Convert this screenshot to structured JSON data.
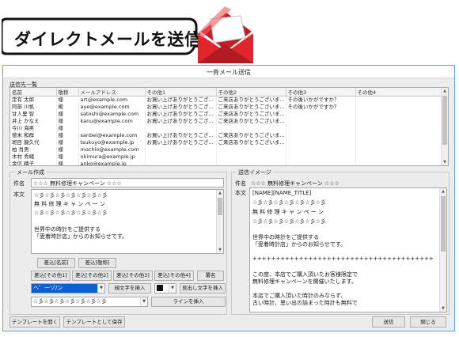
{
  "banner": {
    "text": "ダイレクトメールを送信"
  },
  "window": {
    "title": "一斉メール送信"
  },
  "recipients": {
    "label": "送信先一覧",
    "columns": [
      "名前",
      "敬称",
      "メールアドレス",
      "その他1",
      "その他2",
      "その他3",
      "その他4"
    ],
    "rows": [
      [
        "定有 太郎",
        "様",
        "art@example.com",
        "お買い上げありがとうござ...",
        "ご来店ありがとうございま...",
        "その後いかがですか？",
        ""
      ],
      [
        "阿部 川帆",
        "殿",
        "aye@example.com",
        "お買い上げありがとうござ...",
        "ご来店ありがとうございま...",
        "その後いかがですか？",
        ""
      ],
      [
        "甘人里 智",
        "様",
        "satoshi@example.com",
        "お買い上げありがとうござ...",
        "ご来店ありがとうございま...",
        "",
        ""
      ],
      [
        "井上 かなえ",
        "様",
        "kanu@example.com",
        "お買い上げありがとうござ...",
        "ご来店ありがとうございま...",
        "",
        ""
      ],
      [
        "今川 海男",
        "様",
        "",
        "",
        "",
        "",
        ""
      ],
      [
        "徳米 和群",
        "様",
        "sanbei@example.com",
        "お買い上げありがとうござ...",
        "ご来店ありがとうございま...",
        "",
        ""
      ],
      [
        "斑目 龍久代",
        "様",
        "tsukuyo@example.jp",
        "お買い上げありがとうござ...",
        "ご来店ありがとうございま...",
        "",
        ""
      ],
      [
        "柏 肖男",
        "様",
        "mochio@example.com",
        "",
        "",
        "",
        ""
      ],
      [
        "木村 秀緒",
        "様",
        "nkimura@example.jp",
        "",
        "",
        "",
        ""
      ],
      [
        "金信 精子",
        "様",
        "anko@example.jp",
        "",
        "",
        "",
        ""
      ]
    ]
  },
  "compose": {
    "group_title": "メール作成",
    "subject_label": "件名",
    "subject_value": "☆☆☆ 無料修理キャンペーン ☆☆☆",
    "body_label": "本文",
    "body_lines": [
      "☆彡☆彡☆彡☆彡☆彡☆彡☆彡",
      "無 料 修 理 キ ャ ン ペ ー ン",
      "☆彡☆彡☆彡☆彡☆彡☆彡☆彡",
      "",
      "世界中の時計をご提供する",
      "「愛着時計店」からのお知らせです。"
    ],
    "insert_name": "差込[名前]",
    "insert_honorific": "差込[敬称]",
    "insert_other1": "差込[その他1]",
    "insert_other2": "差込[その他2]",
    "insert_other3": "差込[その他3]",
    "insert_other4": "差込[その他4]",
    "signature": "署名",
    "headline_select": "ヘ゜ーゾ/ン",
    "insert_heading_char": "顔文字を挿入",
    "heading_text": "見出し文字を挿入",
    "line_select": "☆彡☆彡☆彡☆彡☆彡☆彡☆彡",
    "insert_line": "ラインを挿入"
  },
  "preview": {
    "group_title": "送信イメージ",
    "subject_label": "件名",
    "subject_value": "☆☆☆ 無料修理キャンペーン ☆☆☆",
    "body_label": "本文",
    "body_lines": [
      "[NAME][NAME_TITLE]",
      "☆彡☆彡☆彡☆彡☆彡☆彡☆彡",
      "無 料 修 理 キ ャ ン ペ ー ン",
      "☆彡☆彡☆彡☆彡☆彡☆彡☆彡",
      "",
      "世界中の時計をご提供する",
      "「愛着時計店」からのお知らせです。",
      "",
      "+++++++++++++++++++++++++++++++++++++++",
      "",
      "この度、本店でご購入頂いたお客様限定で",
      "無料修理キャンペーンを開催いたします。",
      "",
      "本店でご購入頂いた時計のみならず、",
      "古い時計、思い出の詰まった時計も無料で"
    ]
  },
  "footer": {
    "open_template": "テンプレートを開く",
    "save_template": "テンプレートとして保存",
    "send": "送信",
    "close": "閉じる"
  },
  "colors": {
    "accent": "#5fa7dc",
    "envelope": "#d8252b",
    "select_blue": "#0b5fd0"
  }
}
